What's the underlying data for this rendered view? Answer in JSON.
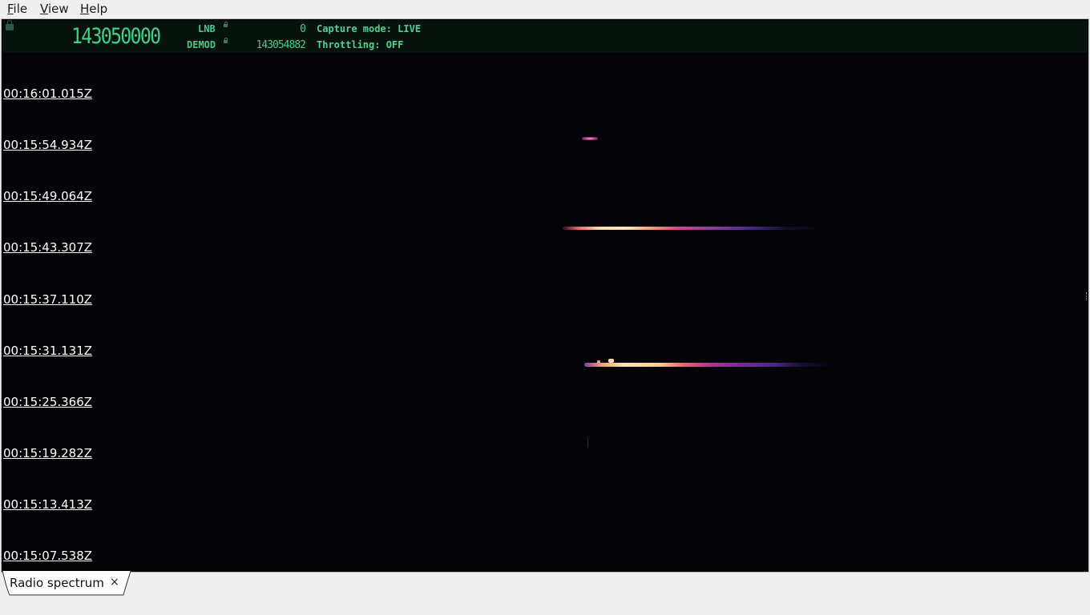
{
  "menu": {
    "file": {
      "acc": "F",
      "rest": "ile"
    },
    "view": {
      "acc": "V",
      "rest": "iew"
    },
    "help": {
      "acc": "H",
      "rest": "elp"
    }
  },
  "header": {
    "main_frequency": "143050000",
    "lnb_label": "LNB",
    "lnb_value": "0",
    "demod_label": "DEMOD",
    "demod_value": "143054882",
    "capture_mode": "Capture mode: LIVE",
    "throttling": "Throttling: OFF"
  },
  "timestamps": [
    "00:16:01.015Z",
    "00:15:54.934Z",
    "00:15:49.064Z",
    "00:15:43.307Z",
    "00:15:37.110Z",
    "00:15:31.131Z",
    "00:15:25.366Z",
    "00:15:19.282Z",
    "00:15:13.413Z",
    "00:15:07.538Z"
  ],
  "tab": {
    "label": "Radio spectrum",
    "close": "×"
  },
  "colors": {
    "waterfall_bg": "#030308",
    "header_text": "#3fd08a",
    "signal_hot": "#ffd8a8",
    "signal_mid": "#d04a8a",
    "signal_cold": "#4a2a8a"
  }
}
